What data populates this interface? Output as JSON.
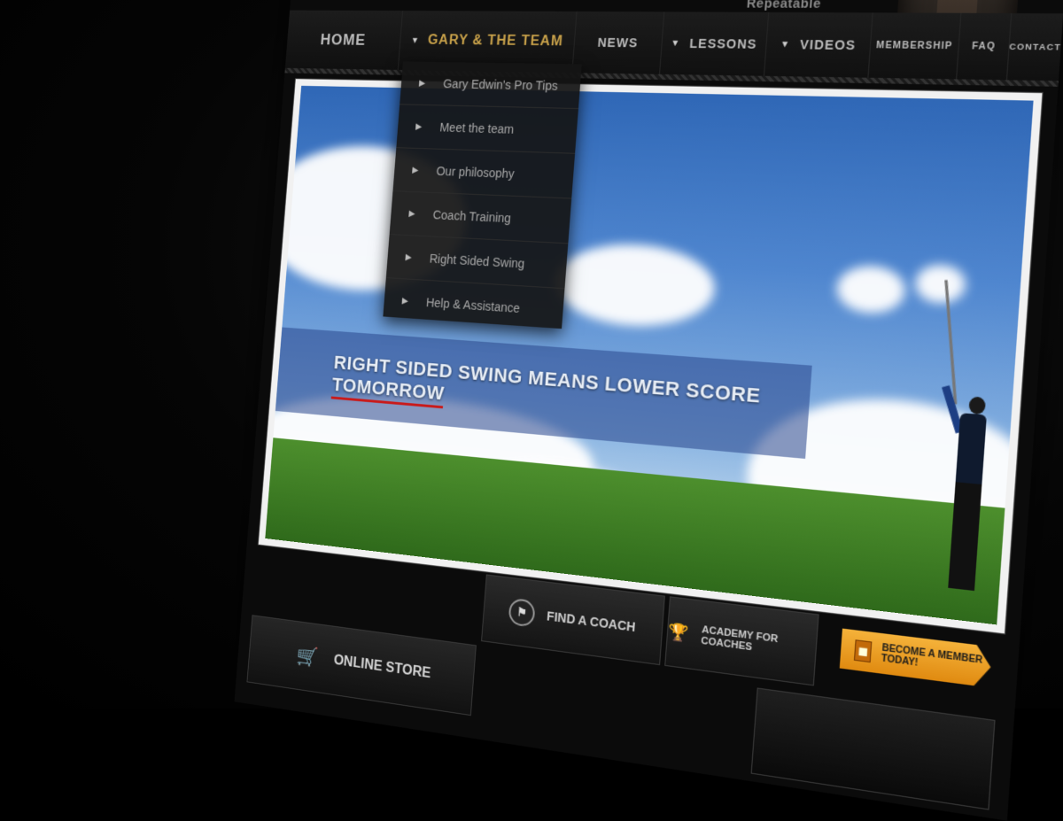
{
  "header": {
    "tagline": "Repeatable"
  },
  "nav": {
    "home": "HOME",
    "gary": "GARY & THE TEAM",
    "news": "NEWS",
    "lessons": "LESSONS",
    "videos": "VIDEOS",
    "membership": "MEMBERSHIP",
    "faq": "FAQ",
    "contact": "CONTACT"
  },
  "dropdown": {
    "items": [
      "Gary Edwin's Pro Tips",
      "Meet the team",
      "Our philosophy",
      "Coach Training",
      "Right Sided Swing",
      "Help & Assistance"
    ]
  },
  "hero": {
    "headline_main": "RIGHT SIDED SWING MEANS LOWER SCORE ",
    "headline_emphasis": "TOMORROW"
  },
  "cta": {
    "find_coach": "FIND A COACH",
    "academy": "ACADEMY FOR COACHES",
    "member": "BECOME A MEMBER TODAY!",
    "online_store": "ONLINE STORE"
  },
  "colors": {
    "accent": "#c9a24a",
    "member_cta": "#f5b23a",
    "emphasis_underline": "#c91a1a"
  },
  "icons": {
    "nav_arrow": "triangle-right-icon",
    "coach": "golf-flag-icon",
    "academy": "trophy-icon",
    "member": "person-icon",
    "store": "shopping-cart-icon"
  }
}
